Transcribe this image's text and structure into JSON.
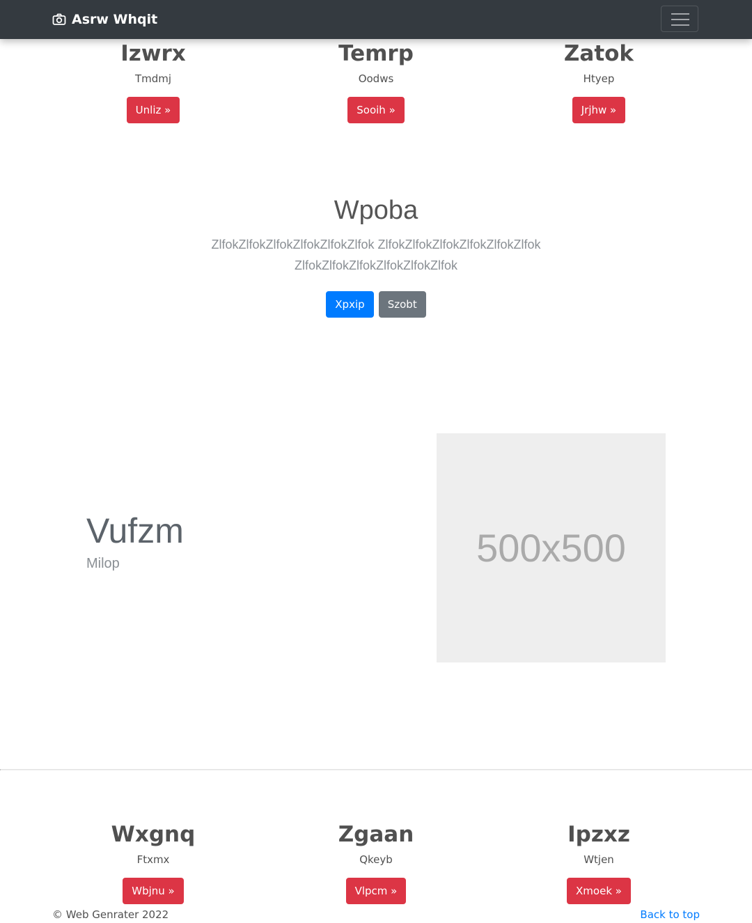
{
  "navbar": {
    "brand": "Asrw Whqit",
    "brand_icon": "camera-icon",
    "toggler_icon": "hamburger-icon"
  },
  "top_columns": [
    {
      "title": "Izwrx",
      "text": "Tmdmj",
      "button": "Unliz »"
    },
    {
      "title": "Temrp",
      "text": "Oodws",
      "button": "Sooih »"
    },
    {
      "title": "Zatok",
      "text": "Htyep",
      "button": "Jrjhw »"
    }
  ],
  "hero": {
    "title": "Wpoba",
    "text": "ZlfokZlfokZlfokZlfokZlfokZlfok ZlfokZlfokZlfokZlfokZlfokZlfok ZlfokZlfokZlfokZlfokZlfokZlfok",
    "primary_button": "Xpxip",
    "secondary_button": "Szobt"
  },
  "feature": {
    "title": "Vufzm",
    "subtitle": "Milop",
    "image_label": "500x500"
  },
  "bottom_columns": [
    {
      "title": "Wxgnq",
      "text": "Ftxmx",
      "button": "Wbjnu »"
    },
    {
      "title": "Zgaan",
      "text": "Qkeyb",
      "button": "Vlpcm »"
    },
    {
      "title": "Ipzxz",
      "text": "Wtjen",
      "button": "Xmoek »"
    }
  ],
  "footer": {
    "copyright": "© Web Genrater 2022",
    "back_to_top": "Back to top"
  },
  "colors": {
    "navbar": "#343a40",
    "danger": "#dc3545",
    "primary": "#007bff",
    "secondary": "#6c757d",
    "placeholder_bg": "#eeeeee"
  }
}
